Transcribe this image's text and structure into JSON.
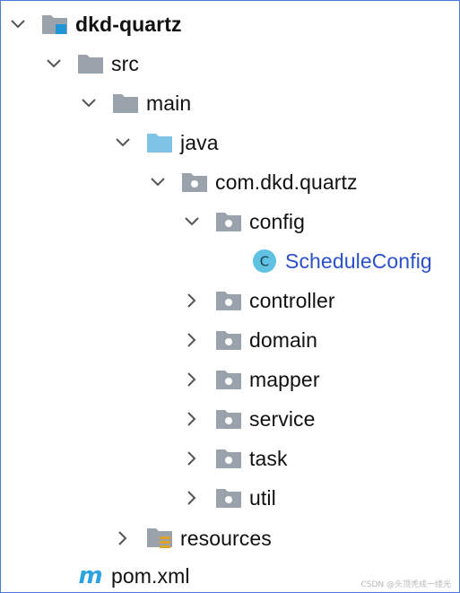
{
  "colors": {
    "chevron": "#555555",
    "folder_gray": "#9aa3ab",
    "folder_blue": "#7fc4e6",
    "module_accent": "#2196d6",
    "class_circle": "#5fc2e3",
    "class_link": "#2b50c8",
    "border": "#4a7fd8"
  },
  "tree": {
    "project": {
      "label": "dkd-quartz",
      "icon": "module-folder-icon",
      "expanded": true
    },
    "src": {
      "label": "src",
      "icon": "folder-icon",
      "expanded": true
    },
    "main": {
      "label": "main",
      "icon": "folder-icon",
      "expanded": true
    },
    "java": {
      "label": "java",
      "icon": "source-root-folder-icon",
      "expanded": true
    },
    "package": {
      "label": "com.dkd.quartz",
      "icon": "package-icon",
      "expanded": true
    },
    "config": {
      "label": "config",
      "icon": "package-icon",
      "expanded": true
    },
    "schedule_config": {
      "label": "ScheduleConfig",
      "icon": "class-icon",
      "badge": "C"
    },
    "controller": {
      "label": "controller",
      "icon": "package-icon",
      "expanded": false
    },
    "domain": {
      "label": "domain",
      "icon": "package-icon",
      "expanded": false
    },
    "mapper": {
      "label": "mapper",
      "icon": "package-icon",
      "expanded": false
    },
    "service": {
      "label": "service",
      "icon": "package-icon",
      "expanded": false
    },
    "task": {
      "label": "task",
      "icon": "package-icon",
      "expanded": false
    },
    "util": {
      "label": "util",
      "icon": "package-icon",
      "expanded": false
    },
    "resources": {
      "label": "resources",
      "icon": "resources-folder-icon",
      "expanded": false
    },
    "pom": {
      "label": "pom.xml",
      "icon": "maven-icon",
      "badge": "m"
    }
  },
  "watermark": "CSDN @头顶秃成一缕光"
}
